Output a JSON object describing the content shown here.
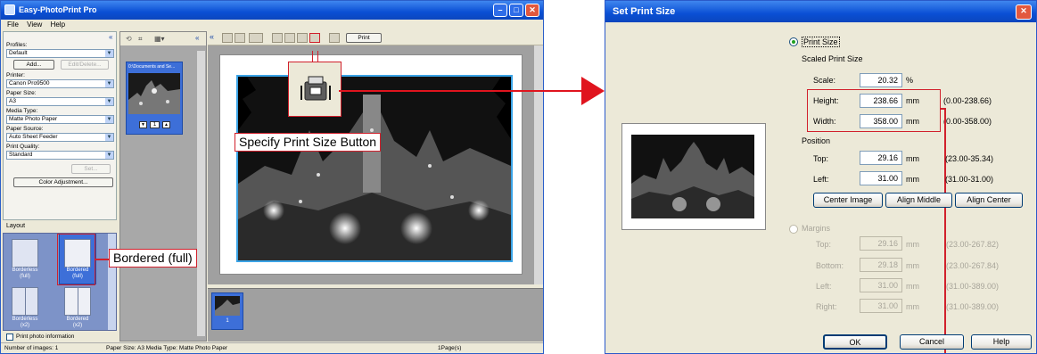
{
  "main_window": {
    "title": "Easy-PhotoPrint Pro",
    "menu": [
      "File",
      "View",
      "Help"
    ],
    "settings": {
      "profiles_label": "Profiles:",
      "profiles_value": "Default",
      "add_button": "Add...",
      "edit_delete_button": "Edit/Delete...",
      "printer_label": "Printer:",
      "printer_value": "Canon Pro9500",
      "paper_size_label": "Paper Size:",
      "paper_size_value": "A3",
      "media_type_label": "Media Type:",
      "media_type_value": "Matte Photo Paper",
      "paper_source_label": "Paper Source:",
      "paper_source_value": "Auto Sheet Feeder",
      "print_quality_label": "Print Quality:",
      "print_quality_value": "Standard",
      "set_button": "Set...",
      "color_adjustment_button": "Color Adjustment..."
    },
    "layout_label": "Layout",
    "layouts": [
      {
        "line1": "Borderless",
        "line2": "(full)"
      },
      {
        "line1": "Bordered",
        "line2": "(full)"
      },
      {
        "line1": "Borderless",
        "line2": "(x2)"
      },
      {
        "line1": "Bordered",
        "line2": "(x2)"
      }
    ],
    "print_photo_info": "Print photo information",
    "thumbnail_path": "0:\\Documents and Se...",
    "thumbnail_page": "1",
    "strip_count": "1",
    "print_button": "Print",
    "status": {
      "images": "Number of images: 1",
      "paper": "Paper Size: A3  Media Type: Matte Photo Paper",
      "pages": "1Page(s)"
    }
  },
  "callouts": {
    "print_size_button": "Specify Print Size Button",
    "bordered_full": "Bordered (full)"
  },
  "dialog": {
    "title": "Set Print Size",
    "print_size_radio": "Print Size",
    "scaled_print_size": "Scaled Print Size",
    "scale_label": "Scale:",
    "scale_value": "20.32",
    "scale_unit": "%",
    "height_label": "Height:",
    "height_value": "238.66",
    "height_unit": "mm",
    "height_range": "(0.00-238.66)",
    "width_label": "Width:",
    "width_value": "358.00",
    "width_unit": "mm",
    "width_range": "(0.00-358.00)",
    "position_label": "Position",
    "top_label": "Top:",
    "top_value": "29.16",
    "top_unit": "mm",
    "top_range": "(23.00-35.34)",
    "left_label": "Left:",
    "left_value": "31.00",
    "left_unit": "mm",
    "left_range": "(31.00-31.00)",
    "center_image": "Center Image",
    "align_middle": "Align Middle",
    "align_center": "Align Center",
    "margins_radio": "Margins",
    "margins": [
      {
        "label": "Top:",
        "value": "29.16",
        "unit": "mm",
        "range": "(23.00-267.82)"
      },
      {
        "label": "Bottom:",
        "value": "29.18",
        "unit": "mm",
        "range": "(23.00-267.84)"
      },
      {
        "label": "Left:",
        "value": "31.00",
        "unit": "mm",
        "range": "(31.00-389.00)"
      },
      {
        "label": "Right:",
        "value": "31.00",
        "unit": "mm",
        "range": "(31.00-389.00)"
      }
    ],
    "ok": "OK",
    "cancel": "Cancel",
    "help": "Help"
  },
  "colors": {
    "callout_red": "#d1202c",
    "arrow_red": "#e0141e",
    "selection_blue": "#3aa3e6",
    "titlebar_blue": "#0a4fd4"
  }
}
